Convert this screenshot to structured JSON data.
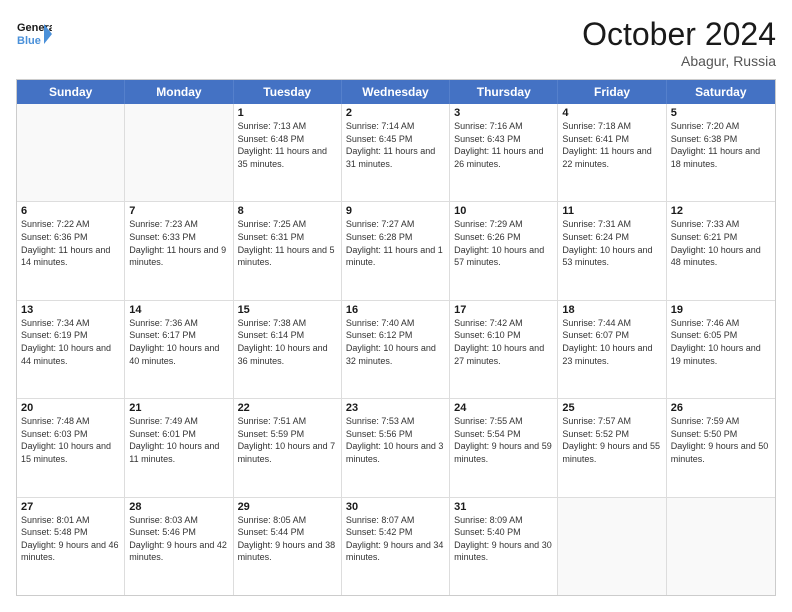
{
  "header": {
    "logo_line1": "General",
    "logo_line2": "Blue",
    "month_title": "October 2024",
    "location": "Abagur, Russia"
  },
  "day_headers": [
    "Sunday",
    "Monday",
    "Tuesday",
    "Wednesday",
    "Thursday",
    "Friday",
    "Saturday"
  ],
  "weeks": [
    [
      {
        "day": "",
        "sunrise": "",
        "sunset": "",
        "daylight": ""
      },
      {
        "day": "",
        "sunrise": "",
        "sunset": "",
        "daylight": ""
      },
      {
        "day": "1",
        "sunrise": "Sunrise: 7:13 AM",
        "sunset": "Sunset: 6:48 PM",
        "daylight": "Daylight: 11 hours and 35 minutes."
      },
      {
        "day": "2",
        "sunrise": "Sunrise: 7:14 AM",
        "sunset": "Sunset: 6:45 PM",
        "daylight": "Daylight: 11 hours and 31 minutes."
      },
      {
        "day": "3",
        "sunrise": "Sunrise: 7:16 AM",
        "sunset": "Sunset: 6:43 PM",
        "daylight": "Daylight: 11 hours and 26 minutes."
      },
      {
        "day": "4",
        "sunrise": "Sunrise: 7:18 AM",
        "sunset": "Sunset: 6:41 PM",
        "daylight": "Daylight: 11 hours and 22 minutes."
      },
      {
        "day": "5",
        "sunrise": "Sunrise: 7:20 AM",
        "sunset": "Sunset: 6:38 PM",
        "daylight": "Daylight: 11 hours and 18 minutes."
      }
    ],
    [
      {
        "day": "6",
        "sunrise": "Sunrise: 7:22 AM",
        "sunset": "Sunset: 6:36 PM",
        "daylight": "Daylight: 11 hours and 14 minutes."
      },
      {
        "day": "7",
        "sunrise": "Sunrise: 7:23 AM",
        "sunset": "Sunset: 6:33 PM",
        "daylight": "Daylight: 11 hours and 9 minutes."
      },
      {
        "day": "8",
        "sunrise": "Sunrise: 7:25 AM",
        "sunset": "Sunset: 6:31 PM",
        "daylight": "Daylight: 11 hours and 5 minutes."
      },
      {
        "day": "9",
        "sunrise": "Sunrise: 7:27 AM",
        "sunset": "Sunset: 6:28 PM",
        "daylight": "Daylight: 11 hours and 1 minute."
      },
      {
        "day": "10",
        "sunrise": "Sunrise: 7:29 AM",
        "sunset": "Sunset: 6:26 PM",
        "daylight": "Daylight: 10 hours and 57 minutes."
      },
      {
        "day": "11",
        "sunrise": "Sunrise: 7:31 AM",
        "sunset": "Sunset: 6:24 PM",
        "daylight": "Daylight: 10 hours and 53 minutes."
      },
      {
        "day": "12",
        "sunrise": "Sunrise: 7:33 AM",
        "sunset": "Sunset: 6:21 PM",
        "daylight": "Daylight: 10 hours and 48 minutes."
      }
    ],
    [
      {
        "day": "13",
        "sunrise": "Sunrise: 7:34 AM",
        "sunset": "Sunset: 6:19 PM",
        "daylight": "Daylight: 10 hours and 44 minutes."
      },
      {
        "day": "14",
        "sunrise": "Sunrise: 7:36 AM",
        "sunset": "Sunset: 6:17 PM",
        "daylight": "Daylight: 10 hours and 40 minutes."
      },
      {
        "day": "15",
        "sunrise": "Sunrise: 7:38 AM",
        "sunset": "Sunset: 6:14 PM",
        "daylight": "Daylight: 10 hours and 36 minutes."
      },
      {
        "day": "16",
        "sunrise": "Sunrise: 7:40 AM",
        "sunset": "Sunset: 6:12 PM",
        "daylight": "Daylight: 10 hours and 32 minutes."
      },
      {
        "day": "17",
        "sunrise": "Sunrise: 7:42 AM",
        "sunset": "Sunset: 6:10 PM",
        "daylight": "Daylight: 10 hours and 27 minutes."
      },
      {
        "day": "18",
        "sunrise": "Sunrise: 7:44 AM",
        "sunset": "Sunset: 6:07 PM",
        "daylight": "Daylight: 10 hours and 23 minutes."
      },
      {
        "day": "19",
        "sunrise": "Sunrise: 7:46 AM",
        "sunset": "Sunset: 6:05 PM",
        "daylight": "Daylight: 10 hours and 19 minutes."
      }
    ],
    [
      {
        "day": "20",
        "sunrise": "Sunrise: 7:48 AM",
        "sunset": "Sunset: 6:03 PM",
        "daylight": "Daylight: 10 hours and 15 minutes."
      },
      {
        "day": "21",
        "sunrise": "Sunrise: 7:49 AM",
        "sunset": "Sunset: 6:01 PM",
        "daylight": "Daylight: 10 hours and 11 minutes."
      },
      {
        "day": "22",
        "sunrise": "Sunrise: 7:51 AM",
        "sunset": "Sunset: 5:59 PM",
        "daylight": "Daylight: 10 hours and 7 minutes."
      },
      {
        "day": "23",
        "sunrise": "Sunrise: 7:53 AM",
        "sunset": "Sunset: 5:56 PM",
        "daylight": "Daylight: 10 hours and 3 minutes."
      },
      {
        "day": "24",
        "sunrise": "Sunrise: 7:55 AM",
        "sunset": "Sunset: 5:54 PM",
        "daylight": "Daylight: 9 hours and 59 minutes."
      },
      {
        "day": "25",
        "sunrise": "Sunrise: 7:57 AM",
        "sunset": "Sunset: 5:52 PM",
        "daylight": "Daylight: 9 hours and 55 minutes."
      },
      {
        "day": "26",
        "sunrise": "Sunrise: 7:59 AM",
        "sunset": "Sunset: 5:50 PM",
        "daylight": "Daylight: 9 hours and 50 minutes."
      }
    ],
    [
      {
        "day": "27",
        "sunrise": "Sunrise: 8:01 AM",
        "sunset": "Sunset: 5:48 PM",
        "daylight": "Daylight: 9 hours and 46 minutes."
      },
      {
        "day": "28",
        "sunrise": "Sunrise: 8:03 AM",
        "sunset": "Sunset: 5:46 PM",
        "daylight": "Daylight: 9 hours and 42 minutes."
      },
      {
        "day": "29",
        "sunrise": "Sunrise: 8:05 AM",
        "sunset": "Sunset: 5:44 PM",
        "daylight": "Daylight: 9 hours and 38 minutes."
      },
      {
        "day": "30",
        "sunrise": "Sunrise: 8:07 AM",
        "sunset": "Sunset: 5:42 PM",
        "daylight": "Daylight: 9 hours and 34 minutes."
      },
      {
        "day": "31",
        "sunrise": "Sunrise: 8:09 AM",
        "sunset": "Sunset: 5:40 PM",
        "daylight": "Daylight: 9 hours and 30 minutes."
      },
      {
        "day": "",
        "sunrise": "",
        "sunset": "",
        "daylight": ""
      },
      {
        "day": "",
        "sunrise": "",
        "sunset": "",
        "daylight": ""
      }
    ]
  ]
}
